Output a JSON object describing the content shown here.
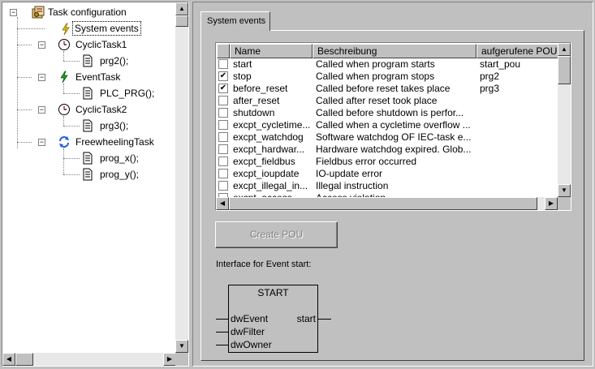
{
  "tree": {
    "items": [
      {
        "label": "Task configuration",
        "icon": "task-config-icon"
      },
      {
        "label": "System events",
        "icon": "lightning-icon",
        "selected": true
      },
      {
        "label": "CyclicTask1",
        "icon": "clock-icon"
      },
      {
        "label": "prg2();",
        "icon": "program-icon"
      },
      {
        "label": "EventTask",
        "icon": "lightning-icon"
      },
      {
        "label": "PLC_PRG();",
        "icon": "program-icon"
      },
      {
        "label": "CyclicTask2",
        "icon": "clock-icon"
      },
      {
        "label": "prg3();",
        "icon": "program-icon"
      },
      {
        "label": "FreewheelingTask",
        "icon": "freewheel-icon"
      },
      {
        "label": "prog_x();",
        "icon": "program-icon"
      },
      {
        "label": "prog_y();",
        "icon": "program-icon"
      }
    ]
  },
  "tab": {
    "label": "System events"
  },
  "events_table": {
    "columns": [
      "Name",
      "Beschreibung",
      "aufgerufene POU"
    ],
    "rows": [
      {
        "checked": false,
        "name": "start",
        "desc": "Called when program starts",
        "pou": "start_pou"
      },
      {
        "checked": true,
        "name": "stop",
        "desc": "Called when program stops",
        "pou": "prg2"
      },
      {
        "checked": true,
        "name": "before_reset",
        "desc": "Called before reset takes place",
        "pou": "prg3"
      },
      {
        "checked": false,
        "name": "after_reset",
        "desc": "Called after reset took place",
        "pou": ""
      },
      {
        "checked": false,
        "name": "shutdown",
        "desc": "Called before shutdown is perfor...",
        "pou": ""
      },
      {
        "checked": false,
        "name": "excpt_cycletime...",
        "desc": "Called when a cycletime overflow ...",
        "pou": ""
      },
      {
        "checked": false,
        "name": "excpt_watchdog",
        "desc": "Software watchdog OF IEC-task e...",
        "pou": ""
      },
      {
        "checked": false,
        "name": "excpt_hardwar...",
        "desc": "Hardware watchdog expired. Glob...",
        "pou": ""
      },
      {
        "checked": false,
        "name": "excpt_fieldbus",
        "desc": "Fieldbus error occurred",
        "pou": ""
      },
      {
        "checked": false,
        "name": "excpt_ioupdate",
        "desc": "IO-update error",
        "pou": ""
      },
      {
        "checked": false,
        "name": "excpt_illegal_in...",
        "desc": "Illegal instruction",
        "pou": ""
      },
      {
        "checked": false,
        "name": "excpt_access",
        "desc": "Access violation",
        "pou": ""
      }
    ]
  },
  "create_pou_button": {
    "label": "Create POU",
    "enabled": false
  },
  "interface": {
    "label": "Interface for Event start:",
    "block_name": "START",
    "inputs": [
      "dwEvent",
      "dwFilter",
      "dwOwner"
    ],
    "output": "start"
  }
}
